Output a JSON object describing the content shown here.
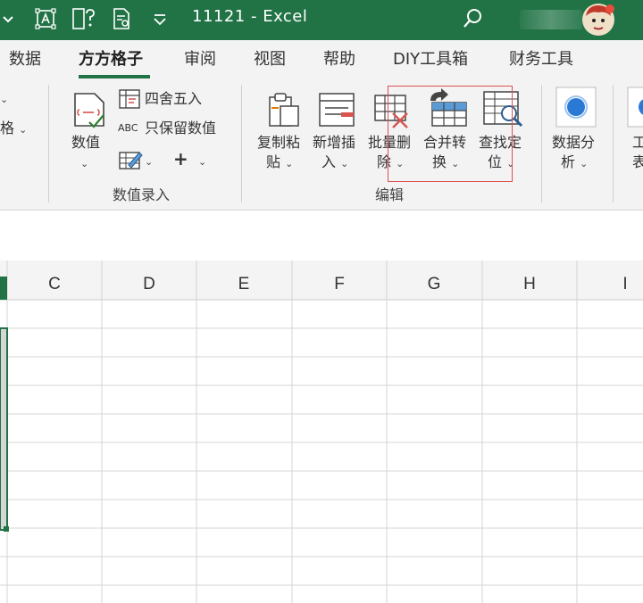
{
  "titlebar": {
    "title": "11121  -  Excel",
    "colors": {
      "background": "#217346",
      "text": "#ffffff"
    },
    "quick_access": [
      "chevron-down-icon",
      "textbox-icon",
      "help-layout-icon",
      "document-search-icon",
      "customize-quick-access-icon"
    ],
    "search_icon": "search-icon",
    "avatar_icon": "avatar"
  },
  "menu": {
    "tabs": [
      {
        "label": "数据"
      },
      {
        "label": "方方格子"
      },
      {
        "label": "审阅"
      },
      {
        "label": "视图"
      },
      {
        "label": "帮助"
      },
      {
        "label": "DIY工具箱"
      },
      {
        "label": "财务工具"
      }
    ],
    "active_tab": "方方格子",
    "accent": "#217346"
  },
  "ribbon": {
    "left_partial": {
      "label": "格"
    },
    "numeric_group": {
      "value_button": {
        "label": "数值"
      },
      "round_button": {
        "label": "四舍五入"
      },
      "keep_numeric_button": {
        "label": "只保留数值",
        "icon_text": "ABC"
      },
      "plus_symbol": "+",
      "group_label": "数值录入"
    },
    "edit_group": {
      "buttons": [
        {
          "line1": "复制粘",
          "line2": "贴"
        },
        {
          "line1": "新增插",
          "line2": "入"
        },
        {
          "line1": "批量删",
          "line2": "除"
        },
        {
          "line1": "合并转",
          "line2": "换"
        },
        {
          "line1": "查找定",
          "line2": "位"
        }
      ],
      "group_label": "编辑"
    },
    "analysis": {
      "line1": "数据分",
      "line2": "析"
    },
    "right_partial": {
      "line1": "工",
      "line2": "表"
    }
  },
  "sheet": {
    "column_headers": [
      "C",
      "D",
      "E",
      "F",
      "G",
      "H",
      "I"
    ],
    "selected_column_color": "#217346"
  },
  "highlight_color": "#e05050"
}
